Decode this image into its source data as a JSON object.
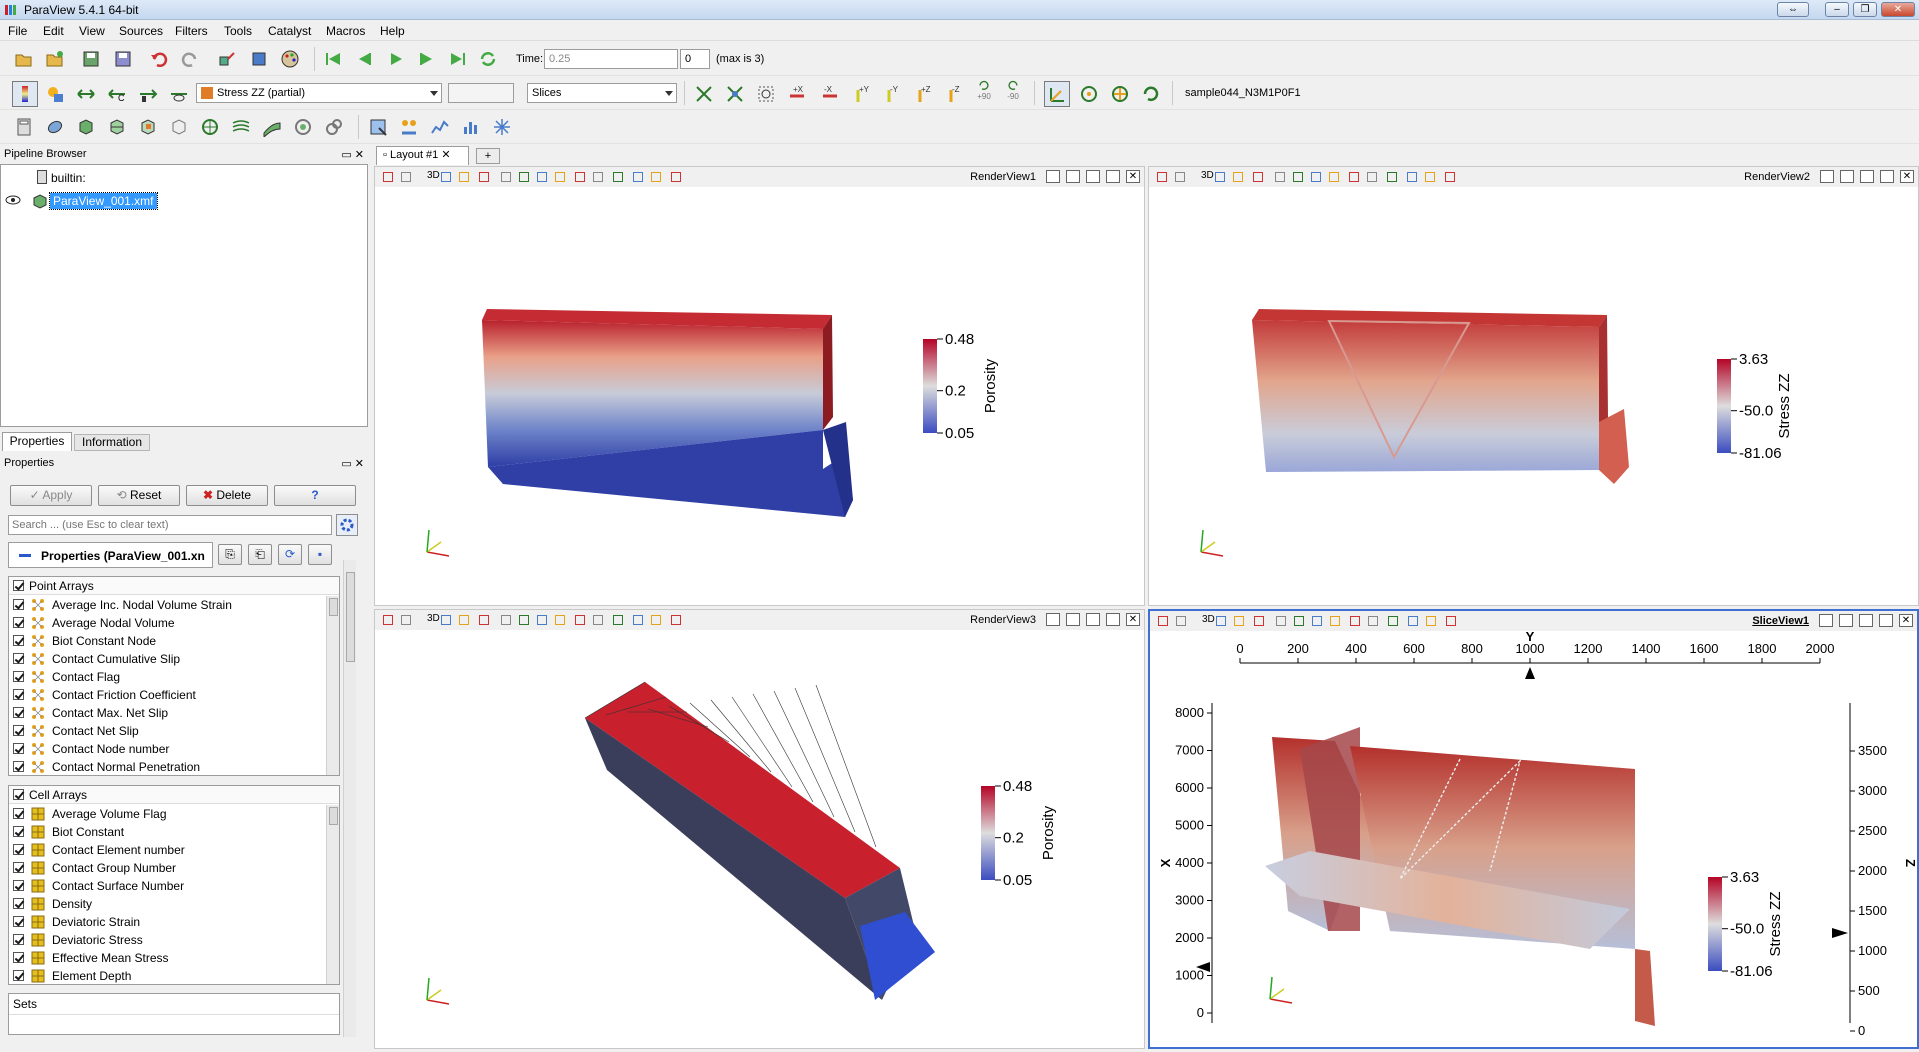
{
  "window": {
    "title": "ParaView 5.4.1 64-bit"
  },
  "menu": [
    "File",
    "Edit",
    "View",
    "Sources",
    "Filters",
    "Tools",
    "Catalyst",
    "Macros",
    "Help"
  ],
  "time": {
    "label": "Time:",
    "value": "0.25",
    "step": "0",
    "max_text": "(max is 3)"
  },
  "toolbar2": {
    "array_combo": "Stress ZZ (partial)",
    "component_combo": "",
    "representation_combo": "Slices",
    "dataset_name": "sample044_N3M1P0F1",
    "rot_plus90": "+90",
    "rot_minus90": "-90"
  },
  "pipeline": {
    "title": "Pipeline Browser",
    "items": [
      {
        "label": "builtin:"
      },
      {
        "label": "ParaView_001.xmf"
      }
    ]
  },
  "tabs": {
    "properties": "Properties",
    "information": "Information"
  },
  "properties": {
    "title": "Properties",
    "apply": "Apply",
    "reset": "Reset",
    "delete": "Delete",
    "help": "?",
    "search_placeholder": "Search ... (use Esc to clear text)",
    "section": "Properties (ParaView_001.xn",
    "point_arrays_header": "Point Arrays",
    "point_arrays": [
      "Average Inc. Nodal Volume Strain",
      "Average Nodal Volume",
      "Biot Constant Node",
      "Contact Cumulative Slip",
      "Contact Flag",
      "Contact Friction Coefficient",
      "Contact Max. Net Slip",
      "Contact Net Slip",
      "Contact Node number",
      "Contact Normal Penetration"
    ],
    "cell_arrays_header": "Cell Arrays",
    "cell_arrays": [
      "Average Volume Flag",
      "Biot Constant",
      "Contact Element number",
      "Contact Group Number",
      "Contact Surface Number",
      "Density",
      "Deviatoric Strain",
      "Deviatoric Stress",
      "Effective Mean Stress",
      "Element Depth"
    ],
    "sets_header": "Sets"
  },
  "layout_tab": {
    "label": "Layout #1",
    "close": "✕",
    "add": "+"
  },
  "views": [
    {
      "name": "RenderView1",
      "label3d": "3D",
      "colorbar": {
        "title": "Porosity",
        "max": "0.48",
        "mid": "0.2",
        "min": "0.05"
      }
    },
    {
      "name": "RenderView2",
      "label3d": "3D",
      "colorbar": {
        "title": "Stress ZZ",
        "max": "3.63",
        "mid": "-50.0",
        "min": "-81.06"
      }
    },
    {
      "name": "RenderView3",
      "label3d": "3D",
      "colorbar": {
        "title": "Porosity",
        "max": "0.48",
        "mid": "0.2",
        "min": "0.05"
      }
    },
    {
      "name": "SliceView1",
      "label3d": "3D",
      "colorbar": {
        "title": "Stress ZZ",
        "max": "3.63",
        "mid": "-50.0",
        "min": "-81.06"
      }
    }
  ],
  "slice_axes": {
    "top_label": "Y",
    "top_ticks": [
      "0",
      "200",
      "400",
      "600",
      "800",
      "1000",
      "1200",
      "1400",
      "1600",
      "1800",
      "2000"
    ],
    "left_label": "X",
    "left_ticks": [
      "8000",
      "7000",
      "6000",
      "5000",
      "4000",
      "3000",
      "2000",
      "1000",
      "0"
    ],
    "right_label": "Z",
    "right_ticks": [
      "3500",
      "3000",
      "2500",
      "2000",
      "1500",
      "1000",
      "500",
      "0"
    ]
  },
  "colors": {
    "accent_blue": "#3f6fd0",
    "red": "#b2202a",
    "blue": "#2f4db3",
    "selection": "#3399ff"
  }
}
